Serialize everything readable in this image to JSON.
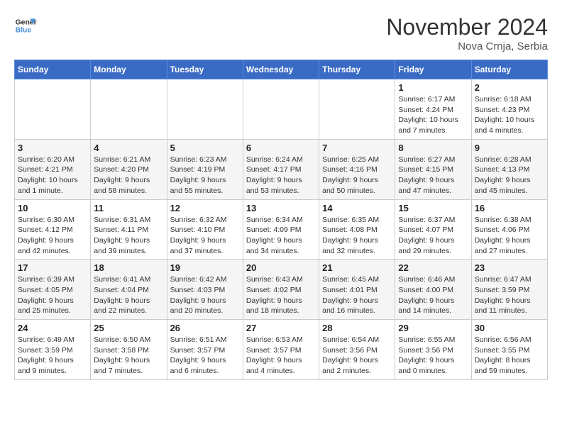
{
  "header": {
    "logo_line1": "General",
    "logo_line2": "Blue",
    "month": "November 2024",
    "location": "Nova Crnja, Serbia"
  },
  "days_of_week": [
    "Sunday",
    "Monday",
    "Tuesday",
    "Wednesday",
    "Thursday",
    "Friday",
    "Saturday"
  ],
  "weeks": [
    [
      {
        "day": "",
        "info": ""
      },
      {
        "day": "",
        "info": ""
      },
      {
        "day": "",
        "info": ""
      },
      {
        "day": "",
        "info": ""
      },
      {
        "day": "",
        "info": ""
      },
      {
        "day": "1",
        "info": "Sunrise: 6:17 AM\nSunset: 4:24 PM\nDaylight: 10 hours and 7 minutes."
      },
      {
        "day": "2",
        "info": "Sunrise: 6:18 AM\nSunset: 4:23 PM\nDaylight: 10 hours and 4 minutes."
      }
    ],
    [
      {
        "day": "3",
        "info": "Sunrise: 6:20 AM\nSunset: 4:21 PM\nDaylight: 10 hours and 1 minute."
      },
      {
        "day": "4",
        "info": "Sunrise: 6:21 AM\nSunset: 4:20 PM\nDaylight: 9 hours and 58 minutes."
      },
      {
        "day": "5",
        "info": "Sunrise: 6:23 AM\nSunset: 4:19 PM\nDaylight: 9 hours and 55 minutes."
      },
      {
        "day": "6",
        "info": "Sunrise: 6:24 AM\nSunset: 4:17 PM\nDaylight: 9 hours and 53 minutes."
      },
      {
        "day": "7",
        "info": "Sunrise: 6:25 AM\nSunset: 4:16 PM\nDaylight: 9 hours and 50 minutes."
      },
      {
        "day": "8",
        "info": "Sunrise: 6:27 AM\nSunset: 4:15 PM\nDaylight: 9 hours and 47 minutes."
      },
      {
        "day": "9",
        "info": "Sunrise: 6:28 AM\nSunset: 4:13 PM\nDaylight: 9 hours and 45 minutes."
      }
    ],
    [
      {
        "day": "10",
        "info": "Sunrise: 6:30 AM\nSunset: 4:12 PM\nDaylight: 9 hours and 42 minutes."
      },
      {
        "day": "11",
        "info": "Sunrise: 6:31 AM\nSunset: 4:11 PM\nDaylight: 9 hours and 39 minutes."
      },
      {
        "day": "12",
        "info": "Sunrise: 6:32 AM\nSunset: 4:10 PM\nDaylight: 9 hours and 37 minutes."
      },
      {
        "day": "13",
        "info": "Sunrise: 6:34 AM\nSunset: 4:09 PM\nDaylight: 9 hours and 34 minutes."
      },
      {
        "day": "14",
        "info": "Sunrise: 6:35 AM\nSunset: 4:08 PM\nDaylight: 9 hours and 32 minutes."
      },
      {
        "day": "15",
        "info": "Sunrise: 6:37 AM\nSunset: 4:07 PM\nDaylight: 9 hours and 29 minutes."
      },
      {
        "day": "16",
        "info": "Sunrise: 6:38 AM\nSunset: 4:06 PM\nDaylight: 9 hours and 27 minutes."
      }
    ],
    [
      {
        "day": "17",
        "info": "Sunrise: 6:39 AM\nSunset: 4:05 PM\nDaylight: 9 hours and 25 minutes."
      },
      {
        "day": "18",
        "info": "Sunrise: 6:41 AM\nSunset: 4:04 PM\nDaylight: 9 hours and 22 minutes."
      },
      {
        "day": "19",
        "info": "Sunrise: 6:42 AM\nSunset: 4:03 PM\nDaylight: 9 hours and 20 minutes."
      },
      {
        "day": "20",
        "info": "Sunrise: 6:43 AM\nSunset: 4:02 PM\nDaylight: 9 hours and 18 minutes."
      },
      {
        "day": "21",
        "info": "Sunrise: 6:45 AM\nSunset: 4:01 PM\nDaylight: 9 hours and 16 minutes."
      },
      {
        "day": "22",
        "info": "Sunrise: 6:46 AM\nSunset: 4:00 PM\nDaylight: 9 hours and 14 minutes."
      },
      {
        "day": "23",
        "info": "Sunrise: 6:47 AM\nSunset: 3:59 PM\nDaylight: 9 hours and 11 minutes."
      }
    ],
    [
      {
        "day": "24",
        "info": "Sunrise: 6:49 AM\nSunset: 3:59 PM\nDaylight: 9 hours and 9 minutes."
      },
      {
        "day": "25",
        "info": "Sunrise: 6:50 AM\nSunset: 3:58 PM\nDaylight: 9 hours and 7 minutes."
      },
      {
        "day": "26",
        "info": "Sunrise: 6:51 AM\nSunset: 3:57 PM\nDaylight: 9 hours and 6 minutes."
      },
      {
        "day": "27",
        "info": "Sunrise: 6:53 AM\nSunset: 3:57 PM\nDaylight: 9 hours and 4 minutes."
      },
      {
        "day": "28",
        "info": "Sunrise: 6:54 AM\nSunset: 3:56 PM\nDaylight: 9 hours and 2 minutes."
      },
      {
        "day": "29",
        "info": "Sunrise: 6:55 AM\nSunset: 3:56 PM\nDaylight: 9 hours and 0 minutes."
      },
      {
        "day": "30",
        "info": "Sunrise: 6:56 AM\nSunset: 3:55 PM\nDaylight: 8 hours and 59 minutes."
      }
    ]
  ]
}
